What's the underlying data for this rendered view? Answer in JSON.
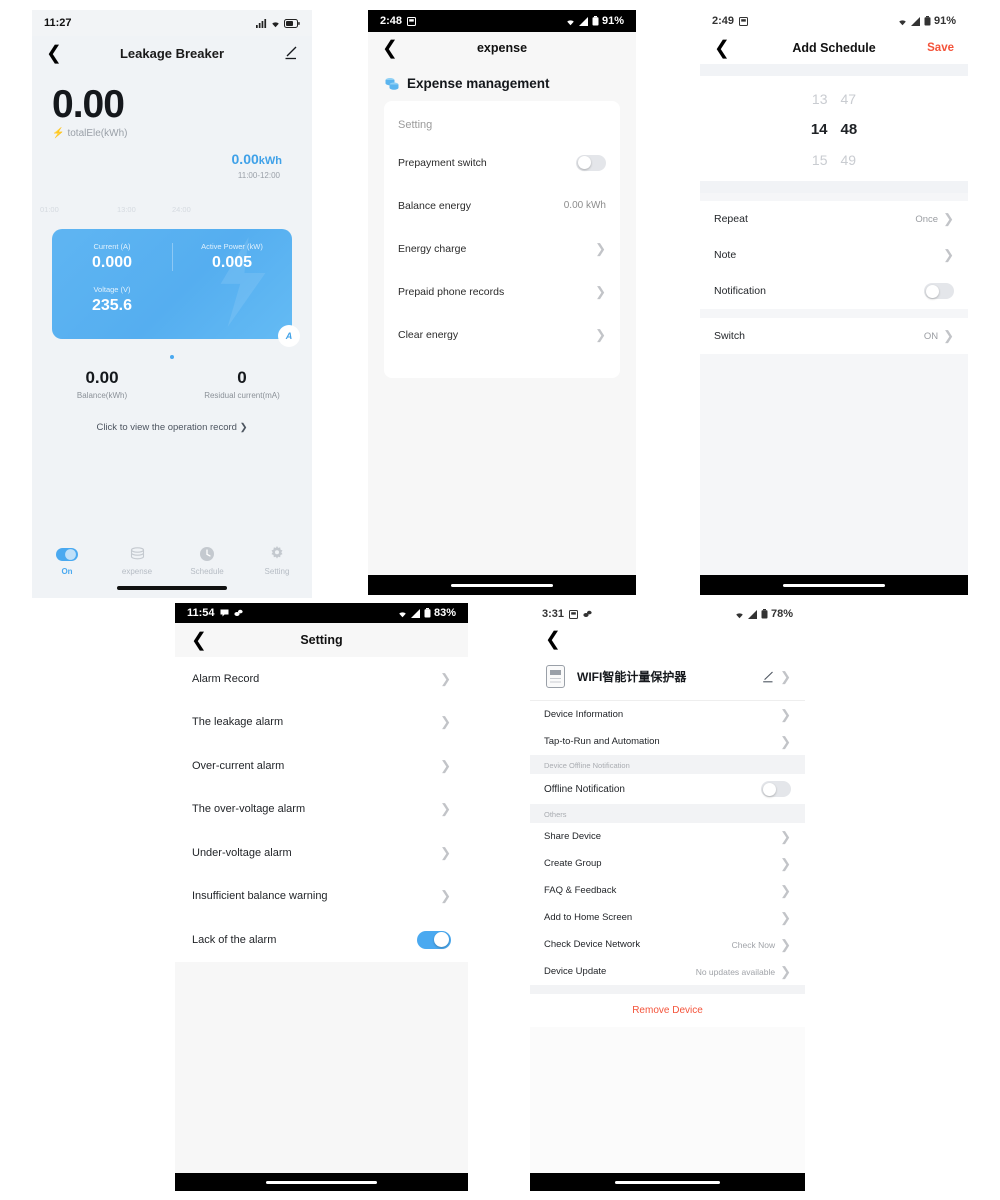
{
  "panels": {
    "leakage_breaker": {
      "status_bar": {
        "time": "11:27"
      },
      "nav": {
        "title": "Leakage Breaker"
      },
      "total": {
        "value": "0.00",
        "label": "totalEle(kWh)"
      },
      "chart": {
        "value": "0.00",
        "unit": "kWh",
        "range": "11:00-12:00",
        "axis": [
          "01:00",
          "13:00",
          "24:00"
        ]
      },
      "metrics": {
        "current_label": "Current (A)",
        "current_value": "0.000",
        "power_label": "Active Power (kW)",
        "power_value": "0.005",
        "voltage_label": "Voltage (V)",
        "voltage_value": "235.6",
        "badge": "A"
      },
      "bottom": {
        "balance_value": "0.00",
        "balance_label": "Balance(kWh)",
        "residual_value": "0",
        "residual_label": "Residual current(mA)"
      },
      "record_link": "Click to view the operation record ❯",
      "tabs": [
        {
          "label": "On",
          "icon": "power-toggle-icon",
          "active": true
        },
        {
          "label": "expense",
          "icon": "coins-icon",
          "active": false
        },
        {
          "label": "Schedule",
          "icon": "clock-icon",
          "active": false
        },
        {
          "label": "Setting",
          "icon": "gear-icon",
          "active": false
        }
      ]
    },
    "expense": {
      "status_bar": {
        "time": "2:48",
        "battery": "91%"
      },
      "nav": {
        "title": "expense"
      },
      "header": {
        "title": "Expense management",
        "icon": "coins-icon"
      },
      "section_label": "Setting",
      "rows": [
        {
          "label": "Prepayment switch",
          "type": "toggle",
          "state": "off"
        },
        {
          "label": "Balance energy",
          "type": "value",
          "value": "0.00 kWh"
        },
        {
          "label": "Energy charge",
          "type": "chevron"
        },
        {
          "label": "Prepaid phone records",
          "type": "chevron"
        },
        {
          "label": "Clear energy",
          "type": "chevron"
        }
      ]
    },
    "add_schedule": {
      "status_bar": {
        "time": "2:49",
        "battery": "91%"
      },
      "nav": {
        "title": "Add Schedule",
        "save": "Save"
      },
      "picker": {
        "prev": {
          "hour": "13",
          "minute": "47"
        },
        "selected": {
          "hour": "14",
          "minute": "48"
        },
        "next": {
          "hour": "15",
          "minute": "49"
        }
      },
      "rows": [
        {
          "label": "Repeat",
          "value": "Once",
          "type": "chevron"
        },
        {
          "label": "Note",
          "value": "",
          "type": "chevron"
        },
        {
          "label": "Notification",
          "type": "toggle",
          "state": "off"
        }
      ],
      "switch_row": {
        "label": "Switch",
        "value": "ON",
        "type": "chevron"
      }
    },
    "setting": {
      "status_bar": {
        "time": "11:54",
        "battery": "83%"
      },
      "nav": {
        "title": "Setting"
      },
      "rows": [
        {
          "label": "Alarm Record",
          "type": "chevron"
        },
        {
          "label": "The leakage alarm",
          "type": "chevron"
        },
        {
          "label": "Over-current alarm",
          "type": "chevron"
        },
        {
          "label": "The over-voltage alarm",
          "type": "chevron"
        },
        {
          "label": "Under-voltage alarm",
          "type": "chevron"
        },
        {
          "label": "Insufficient balance warning",
          "type": "chevron"
        },
        {
          "label": "Lack of the alarm",
          "type": "toggle",
          "state": "on"
        }
      ]
    },
    "device_detail": {
      "status_bar": {
        "time": "3:31",
        "battery": "78%"
      },
      "device": {
        "name": "WIFI智能计量保护器",
        "icon": "device-icon"
      },
      "rows_top": [
        {
          "label": "Device Information",
          "type": "chevron"
        },
        {
          "label": "Tap-to-Run and Automation",
          "type": "chevron"
        }
      ],
      "section_offline": "Device Offline Notification",
      "offline_row": {
        "label": "Offline Notification",
        "type": "toggle",
        "state": "off"
      },
      "section_others": "Others",
      "rows_others": [
        {
          "label": "Share Device",
          "value": "",
          "type": "chevron"
        },
        {
          "label": "Create Group",
          "value": "",
          "type": "chevron"
        },
        {
          "label": "FAQ & Feedback",
          "value": "",
          "type": "chevron"
        },
        {
          "label": "Add to Home Screen",
          "value": "",
          "type": "chevron"
        },
        {
          "label": "Check Device Network",
          "value": "Check Now",
          "type": "chevron"
        },
        {
          "label": "Device Update",
          "value": "No updates available",
          "type": "chevron"
        }
      ],
      "remove": "Remove Device"
    }
  },
  "colors": {
    "accent_blue": "#4aa9f0",
    "danger_red": "#f4533a",
    "card_blue": "#5fb5f2"
  }
}
